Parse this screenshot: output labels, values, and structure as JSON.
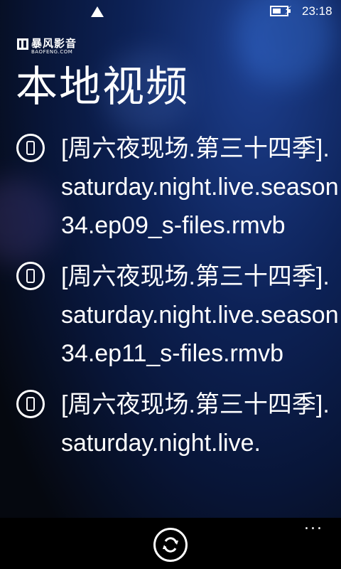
{
  "status": {
    "time": "23:18",
    "battery_level": 0.6,
    "icons": [
      "signal-icon",
      "battery-charging-icon"
    ]
  },
  "app": {
    "logo_cn": "暴风影音",
    "logo_en": "BAOFENG.COM",
    "title": "本地视频"
  },
  "items": [
    {
      "name": "[周六夜现场.第三十四季].saturday.night.live.season34.ep09_s-files.rmvb",
      "icon": "phone-icon"
    },
    {
      "name": "[周六夜现场.第三十四季].saturday.night.live.season34.ep11_s-files.rmvb",
      "icon": "phone-icon"
    },
    {
      "name": "[周六夜现场.第三十四季].saturday.night.live.",
      "icon": "phone-icon"
    }
  ],
  "appbar": {
    "refresh_icon": "refresh-icon",
    "more_label": "..."
  }
}
